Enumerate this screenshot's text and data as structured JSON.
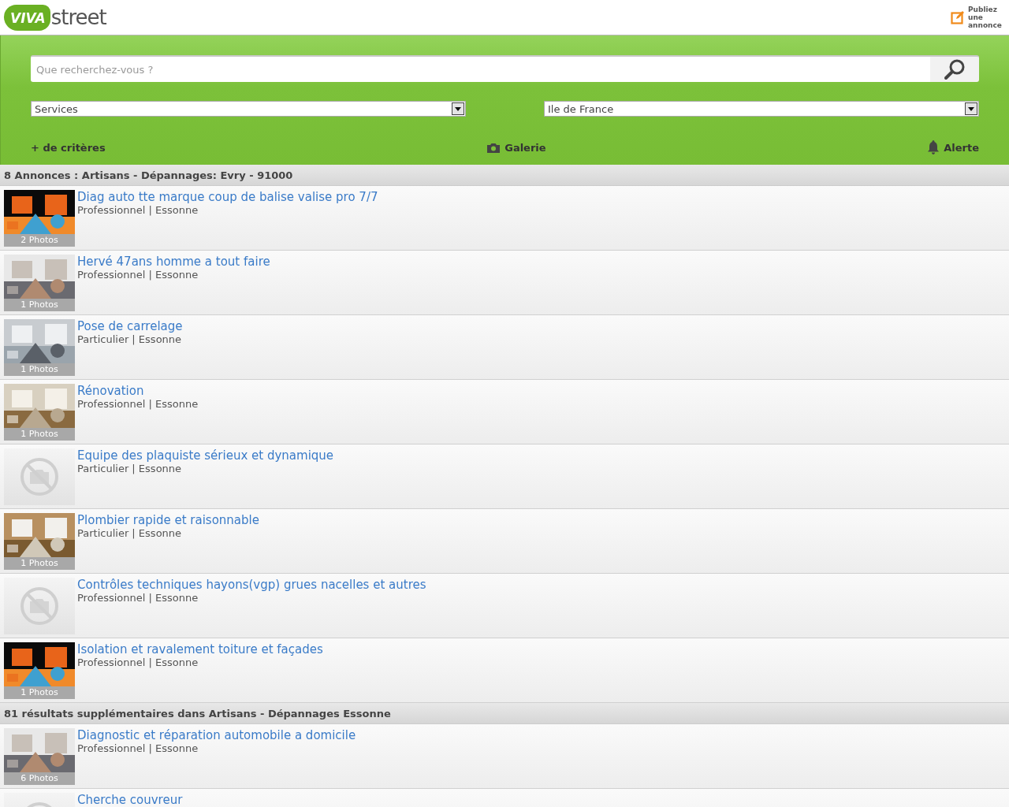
{
  "header": {
    "logo_mark": "VIVA",
    "logo_word": "street",
    "publish": "Publiez une annonce"
  },
  "search": {
    "placeholder": "Que recherchez-vous ?",
    "category": "Services",
    "region": "Ile de France"
  },
  "actions": {
    "criteria": "+ de critères",
    "gallery": "Galerie",
    "alert": "Alerte"
  },
  "sections": [
    {
      "heading": "8 Annonces : Artisans - Dépannages: Evry - 91000",
      "listings": [
        {
          "title": "Diag auto tte marque coup de balise valise pro 7/7",
          "meta": "Professionnel | Essonne",
          "thumb": {
            "photos": "2 Photos"
          }
        },
        {
          "title": "Hervé 47ans homme a tout faire",
          "meta": "Professionnel | Essonne",
          "thumb": {
            "photos": "1 Photos"
          }
        },
        {
          "title": "Pose de carrelage",
          "meta": "Particulier | Essonne",
          "thumb": {
            "photos": "1 Photos"
          }
        },
        {
          "title": "Rénovation",
          "meta": "Professionnel | Essonne",
          "thumb": {
            "photos": "1 Photos"
          }
        },
        {
          "title": "Equipe des plaquiste sérieux et dynamique",
          "meta": "Particulier | Essonne",
          "thumb": {
            "kind": "none"
          }
        },
        {
          "title": "Plombier rapide et raisonnable",
          "meta": "Particulier | Essonne",
          "thumb": {
            "photos": "1 Photos"
          }
        },
        {
          "title": "Contrôles techniques hayons(vgp) grues nacelles et autres",
          "meta": "Professionnel | Essonne",
          "thumb": {
            "kind": "none"
          }
        },
        {
          "title": "Isolation et ravalement toiture et façades",
          "meta": "Professionnel | Essonne",
          "thumb": {
            "photos": "1 Photos"
          }
        }
      ]
    },
    {
      "heading": "81 résultats supplémentaires dans Artisans - Dépannages Essonne",
      "listings": [
        {
          "title": "Diagnostic et réparation automobile a domicile",
          "meta": "Professionnel | Essonne",
          "thumb": {
            "photos": "6 Photos"
          }
        },
        {
          "title": "Cherche couvreur",
          "thumb": {
            "kind": "none"
          }
        }
      ]
    }
  ]
}
